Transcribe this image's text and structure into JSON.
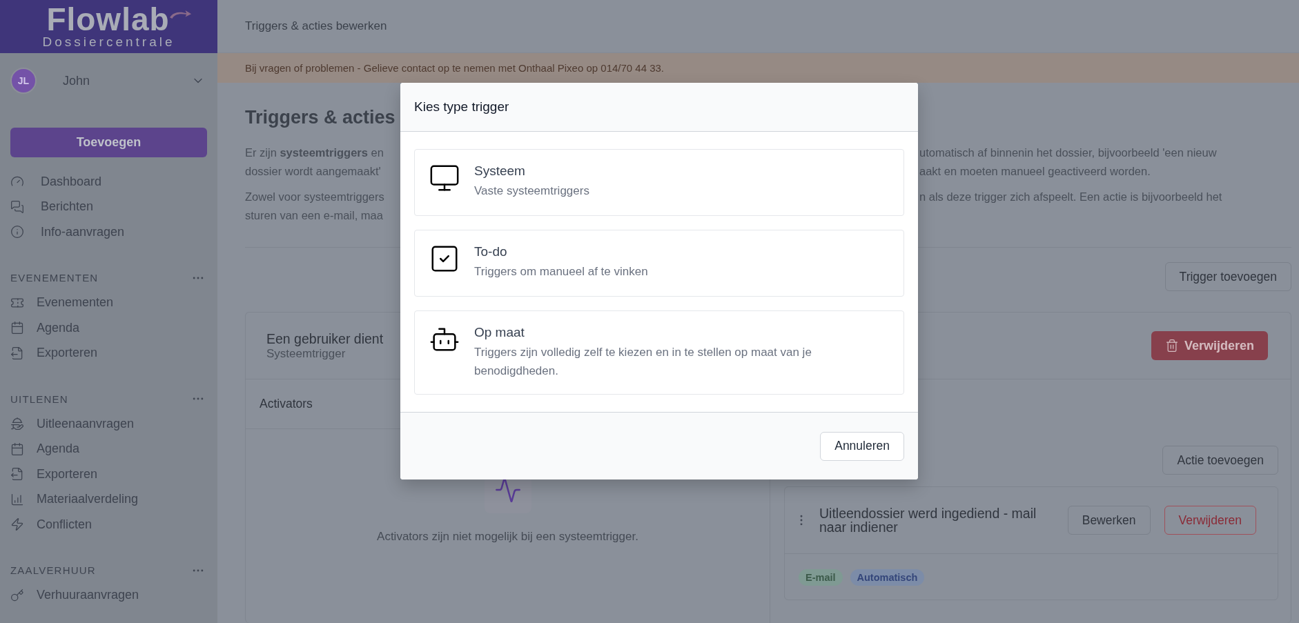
{
  "sidebar": {
    "logo": {
      "name": "Flowlab",
      "tagline": "Dossiercentrale"
    },
    "user": {
      "initials": "JL",
      "name": "John"
    },
    "add_button": "Toevoegen",
    "items": [
      "Dashboard",
      "Berichten",
      "Info-aanvragen"
    ],
    "sections": [
      {
        "title": "EVENEMENTEN",
        "items": [
          "Evenementen",
          "Agenda",
          "Exporteren"
        ]
      },
      {
        "title": "UITLENEN",
        "items": [
          "Uitleenaanvragen",
          "Agenda",
          "Exporteren",
          "Materiaalverdeling",
          "Conflicten"
        ]
      },
      {
        "title": "ZAALVERHUUR",
        "items": [
          "Verhuuraanvragen"
        ]
      }
    ]
  },
  "header": {
    "title": "Triggers & acties bewerken"
  },
  "banner": "Bij vragen of problemen - Gelieve contact op te nemen met Onthaal Pixeo op 014/70 44 33.",
  "page": {
    "title": "Triggers & acties",
    "paragraphs": [
      {
        "left_lines": [
          "Er zijn **systeemtriggers** en",
          "dossier wordt aangemaakt'"
        ],
        "right_lines": [
          "utomatisch af binnenin het dossier, bijvoorbeeld 'een nieuw",
          "aakt en moeten manueel geactiveerd worden."
        ]
      },
      {
        "left_lines": [
          "Zowel voor systeemtriggers",
          "sturen van een e-mail, maa"
        ],
        "right_lines": [
          "n als deze trigger zich afspeelt. Een actie is bijvoorbeeld het"
        ]
      }
    ],
    "add_trigger_button": "Trigger toevoegen",
    "trigger": {
      "title": "Een gebruiker dient",
      "subtitle": "Systeemtrigger",
      "delete_button": "Verwijderen",
      "activators": {
        "title": "Activators",
        "empty_text": "Activators zijn niet mogelijk bij een systeemtrigger."
      },
      "actions": {
        "add_button": "Actie toevoegen",
        "items": [
          {
            "title": "Uitleendossier werd ingediend - mail naar indiener",
            "edit_button": "Bewerken",
            "delete_button": "Verwijderen",
            "tags": [
              {
                "label": "E-mail",
                "color": "#7f9a93"
              },
              {
                "label": "Automatisch",
                "color": "#7c8ca8"
              }
            ]
          }
        ]
      }
    }
  },
  "modal": {
    "title": "Kies type trigger",
    "options": [
      {
        "kind": "system",
        "title": "Systeem",
        "description": "Vaste systeemtriggers"
      },
      {
        "kind": "todo",
        "title": "To-do",
        "description": "Triggers om manueel af te vinken"
      },
      {
        "kind": "custom",
        "title": "Op maat",
        "description": "Triggers zijn volledig zelf te kiezen en in te stellen op maat van je benodigdheden."
      }
    ],
    "cancel_button": "Annuleren"
  }
}
